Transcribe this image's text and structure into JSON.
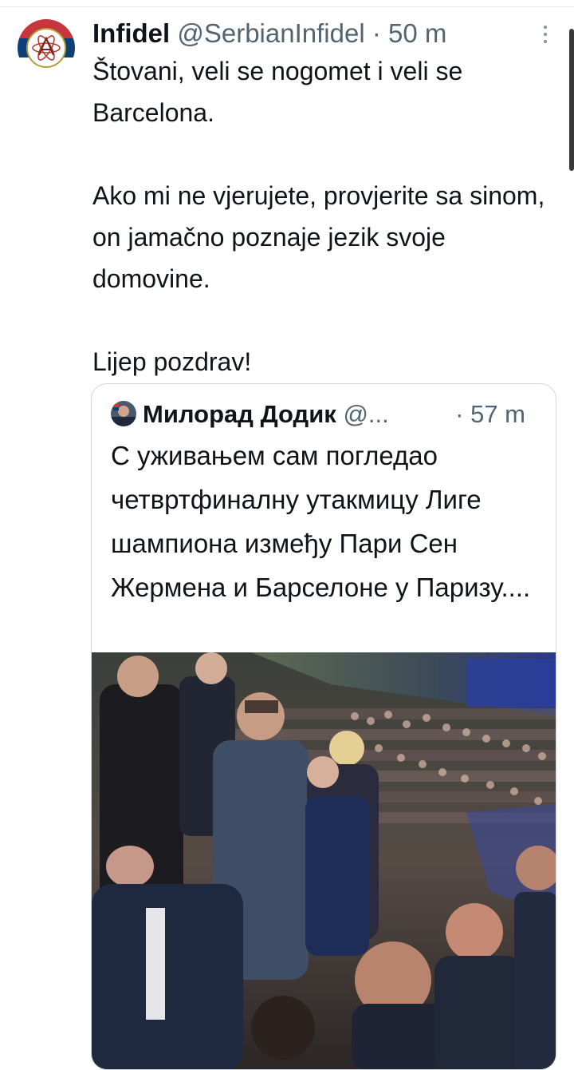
{
  "tweet": {
    "author_name": "Infidel",
    "author_handle": "@SerbianInfidel",
    "separator": "·",
    "time": "50 m",
    "paragraphs": [
      "Štovani, veli se nogomet i veli se Barcelona.",
      "Ako mi ne vjerujete, provjerite sa sinom, on jamačno poznaje jezik svoje domovine.",
      "Lijep pozdrav!"
    ]
  },
  "quoted_tweet": {
    "author_name": "Милорад Додик",
    "author_handle": "@...",
    "separator": "·",
    "time": "57 m",
    "text": "С уживањем сам погледао четвртфиналну утакмицу Лиге шампиона између Пари Сен Жермена и Барселоне у Паризу....",
    "media": "stadium-crowd-photo"
  },
  "icons": {
    "avatar": "atom-emblem-avatar",
    "more": "more-vertical-icon"
  },
  "colors": {
    "text": "#0f1419",
    "muted": "#536471",
    "border": "#cfd9de"
  }
}
